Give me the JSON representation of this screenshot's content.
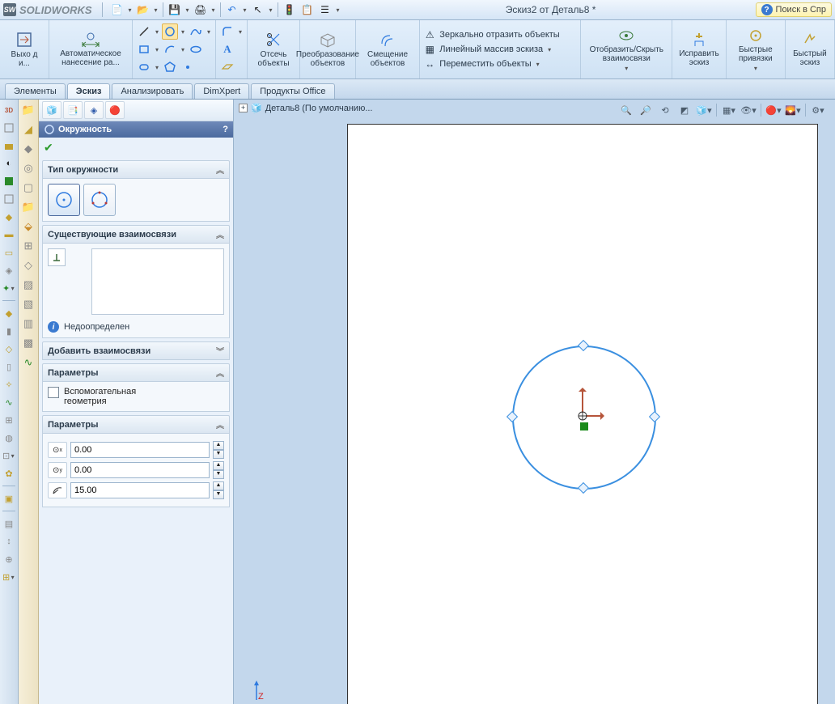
{
  "app_name": "SOLIDWORKS",
  "title": "Эскиз2 от Деталь8 *",
  "search_placeholder": "Поиск в Спр",
  "ribbon": {
    "exit": "Выхо д и...",
    "auto_dim": "Автоматическое нанесение ра...",
    "trim": "Отсечь объекты",
    "convert": "Преобразование объектов",
    "offset": "Смещение объектов",
    "mirror": "Зеркально отразить объекты",
    "linear_pattern": "Линейный массив эскиза",
    "move": "Переместить объекты",
    "show_relations": "Отобразить/Скрыть взаимосвязи",
    "repair": "Исправить эскиз",
    "quick_snaps": "Быстрые привязки",
    "rapid_sketch": "Быстрый эскиз"
  },
  "tabs": [
    "Элементы",
    "Эскиз",
    "Анализировать",
    "DimXpert",
    "Продукты Office"
  ],
  "active_tab": "Эскиз",
  "crumb": "Деталь8  (По умолчанию...",
  "panel": {
    "title": "Окружность",
    "s1": "Тип окружности",
    "s2": "Существующие взаимосвязи",
    "status": "Недоопределен",
    "s3": "Добавить взаимосвязи",
    "s4": "Параметры",
    "aux": "Вспомогательная геометрия",
    "s5": "Параметры",
    "cx": "0.00",
    "cy": "0.00",
    "r": "15.00"
  },
  "axis_z": "Z"
}
